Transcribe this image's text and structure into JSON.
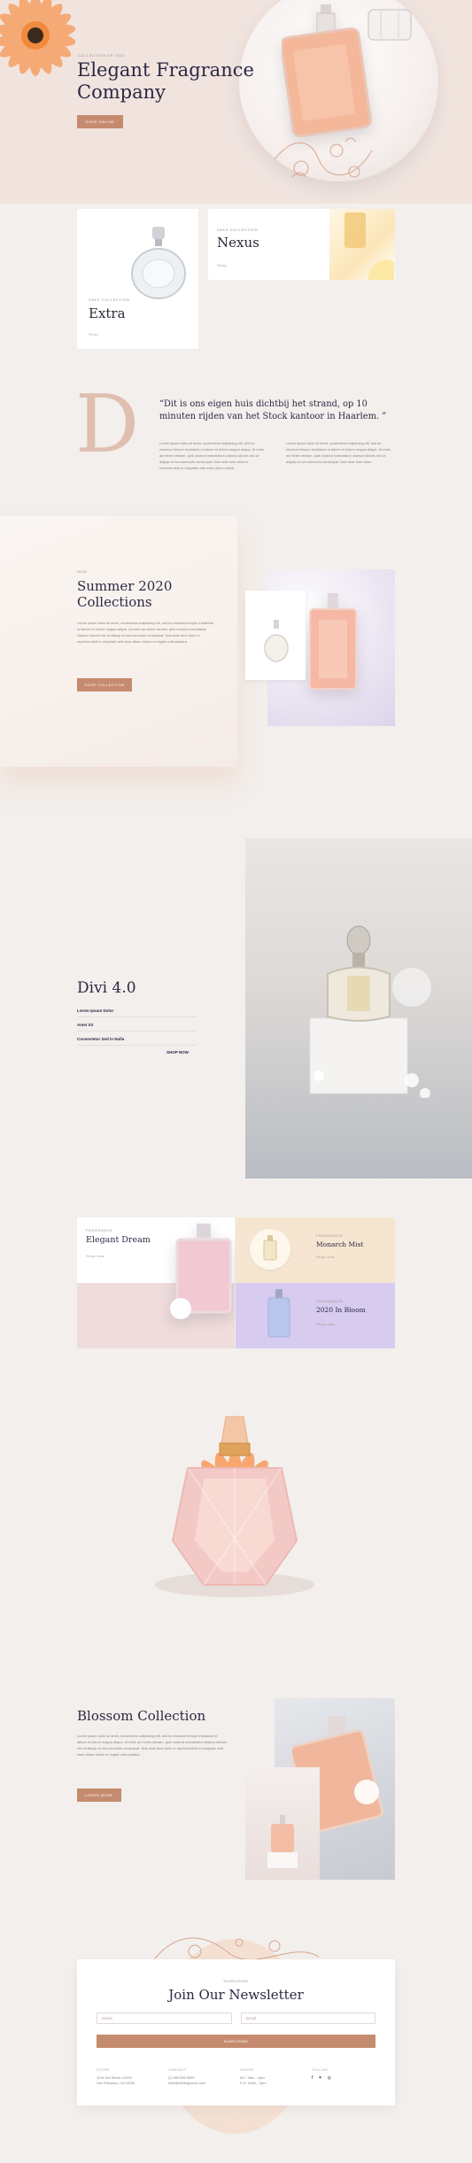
{
  "hero": {
    "eyebrow": "Collection of 2020",
    "title_line1": "Elegant Fragrance",
    "title_line2": "Company",
    "cta": "Shop Online"
  },
  "collections": [
    {
      "eyebrow": "Saks Collection",
      "title": "Extra",
      "link": "Shop"
    },
    {
      "eyebrow": "Saks Collection",
      "title": "Nexus",
      "link": "Shop"
    }
  ],
  "quote": {
    "drop_letter": "D",
    "text": "“Dit is ons eigen huis dichtbij het strand, op 10 minuten rijden van het Stock kantoor in Haarlem. ”",
    "col1": "Lorem ipsum dolor sit amet, consectetur adipiscing elit, sed do eiusmod tempor incididunt ut labore et dolore magna aliqua. Ut enim ad minim veniam, quis nostrud exercitation ullamco laboris nisi ut aliquip ex ea commodo consequat. Duis aute irure dolor in reprehenderit in voluptate velit esse cillum dolore.",
    "col2": "Lorem ipsum dolor sit amet, consectetur adipiscing elit, sed do eiusmod tempor incididunt ut labore et dolore magna aliqua. Ut enim ad minim veniam, quis nostrud exercitation ullamco laboris nisi ut aliquip ex ea commodo consequat. Duis aute irure dolor."
  },
  "summer": {
    "eyebrow": "New",
    "title_line1": "Summer 2020",
    "title_line2": "Collections",
    "text": "Lorem ipsum dolor sit amet, consectetur adipiscing elit, sed do eiusmod tempor incididunt ut labore et dolore magna aliqua. Ut enim ad minim veniam, quis nostrud exercitation ullamco laboris nisi ut aliquip ex ea commodo consequat. Duis aute irure dolor in reprehenderit in voluptate velit esse cillum dolore eu fugiat nulla pariatur.",
    "cta": "Shop Collection"
  },
  "divi": {
    "title": "Divi 4.0",
    "items": [
      "Lorem Ipsum Dolor",
      "Amet Sit",
      "Consectetur Sed In Nulla"
    ],
    "cta": "Shop Now"
  },
  "products": [
    {
      "eyebrow": "Fragrance",
      "title": "Elegant Dream",
      "link": "Shop now"
    },
    {
      "eyebrow": "Fragrance",
      "title": "Monarch Mist",
      "link": "Shop now"
    },
    {
      "eyebrow": "Fragrance",
      "title": "2020 In Bloom",
      "link": "Shop now"
    }
  ],
  "blossom": {
    "title": "Blossom Collection",
    "text": "Lorem ipsum dolor sit amet, consectetur adipiscing elit, sed do eiusmod tempor incididunt ut labore et dolore magna aliqua. Ut enim ad minim veniam, quis nostrud exercitation ullamco laboris nisi ut aliquip ex ea commodo consequat. Duis aute irure dolor in reprehenderit in voluptate velit esse cillum dolore eu fugiat nulla pariatur.",
    "cta": "Learn More"
  },
  "newsletter": {
    "eyebrow": "Subscribe",
    "title": "Join Our Newsletter",
    "name_placeholder": "Name",
    "email_placeholder": "Email",
    "submit": "Subscribe"
  },
  "footer": {
    "store_h": "Store",
    "store_1": "1234 Divi Street, #1000",
    "store_2": "San Francisco, CA 93152",
    "contact_h": "Contact",
    "contact_1": "(1) 555-555-5555",
    "contact_2": "hello@divifragrance.com",
    "hours_h": "Hours",
    "hours_1": "M-F: 9am – 6pm",
    "hours_2": "S-S: 10am – 5pm",
    "follow_h": "Follow",
    "social": [
      "f",
      "✦",
      "◎"
    ]
  },
  "colors": {
    "accent": "#c58b6e",
    "background": "#f3efec",
    "peach": "#f6e6d1",
    "pink": "#efdcdc",
    "lavender": "#d7cbef"
  }
}
